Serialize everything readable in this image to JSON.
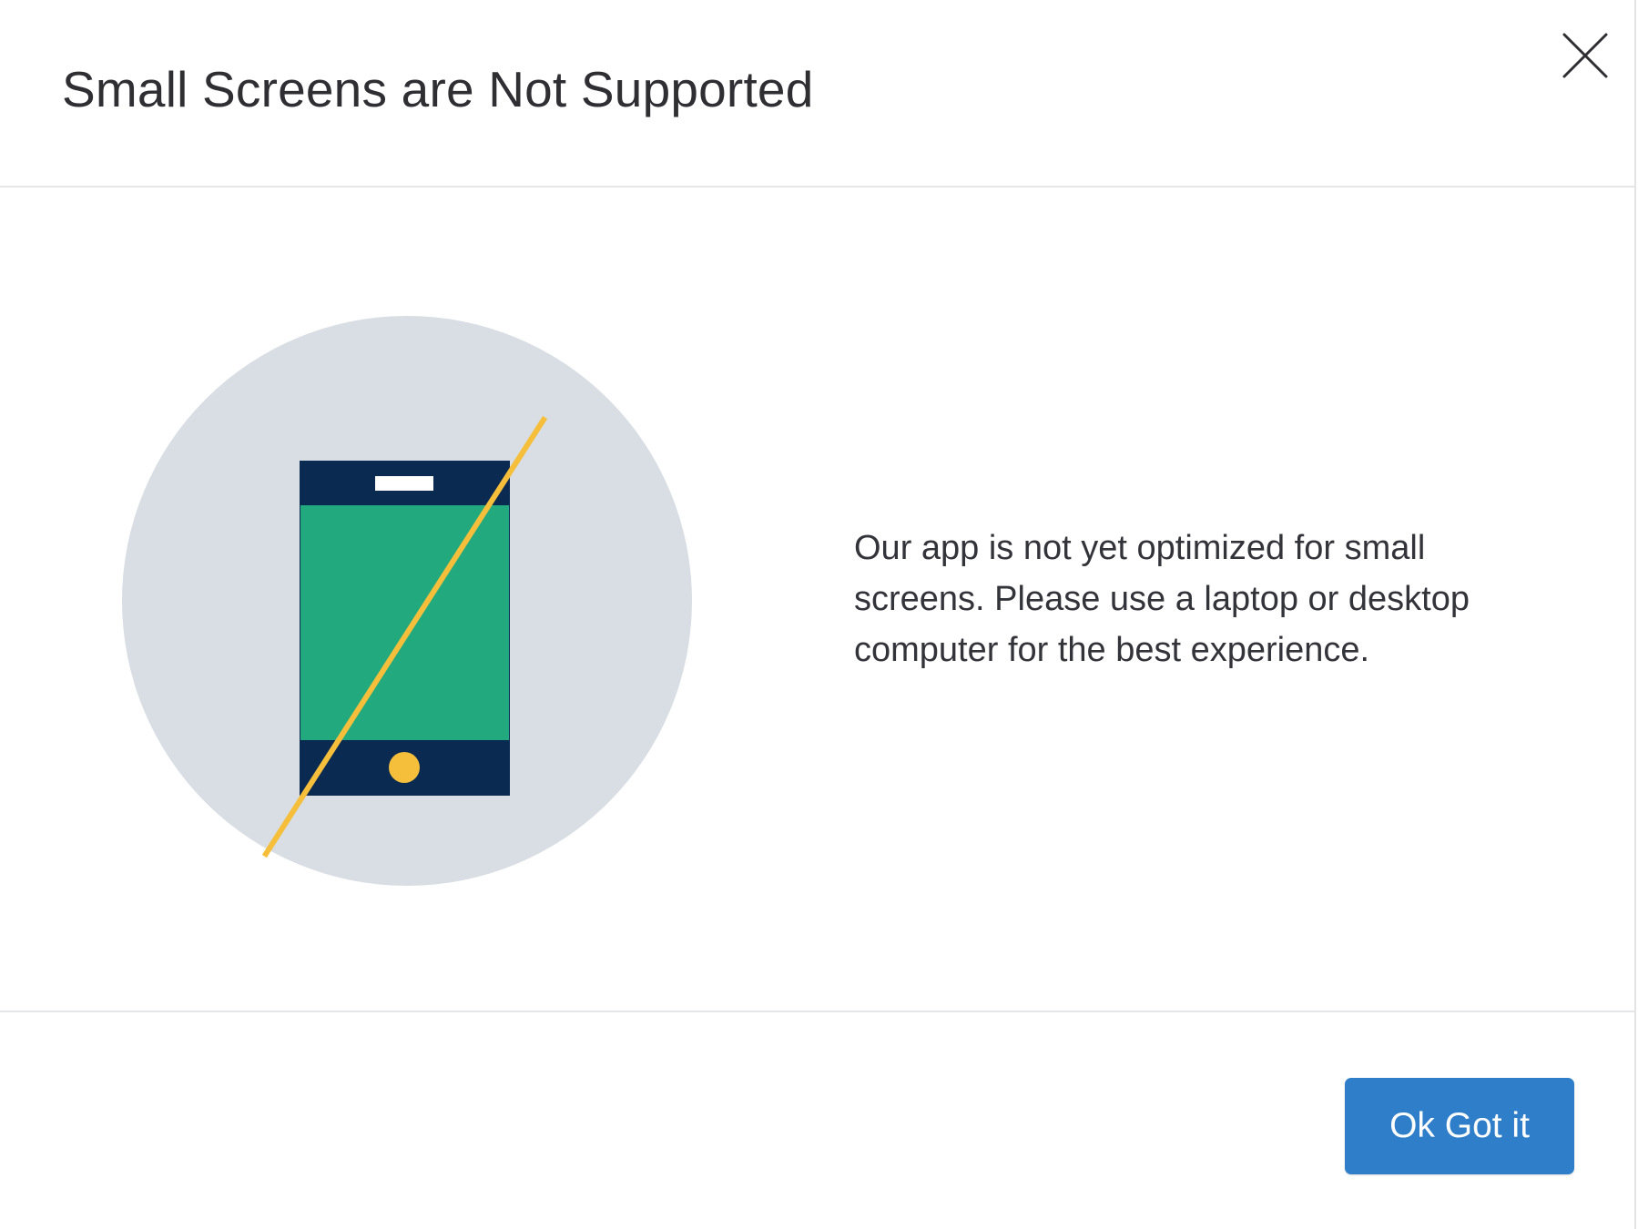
{
  "dialog": {
    "title": "Small Screens are Not Supported",
    "close_icon": "close-icon",
    "message": "Our app is not yet optimized for small screens. Please use a laptop or desktop computer for the best experience.",
    "confirm_label": "Ok Got it"
  },
  "illustration": {
    "icon": "no-phone-icon",
    "colors": {
      "circle": "#d8dee3",
      "phone_body": "#0b2a52",
      "phone_screen": "#22a97d",
      "slash": "#f5bf3c",
      "home_button": "#f5bf3c",
      "speaker": "#ffffff"
    }
  },
  "colors": {
    "primary_button": "#2e7ec9",
    "divider": "#e4e6e8",
    "title_text": "#2e2e33"
  }
}
